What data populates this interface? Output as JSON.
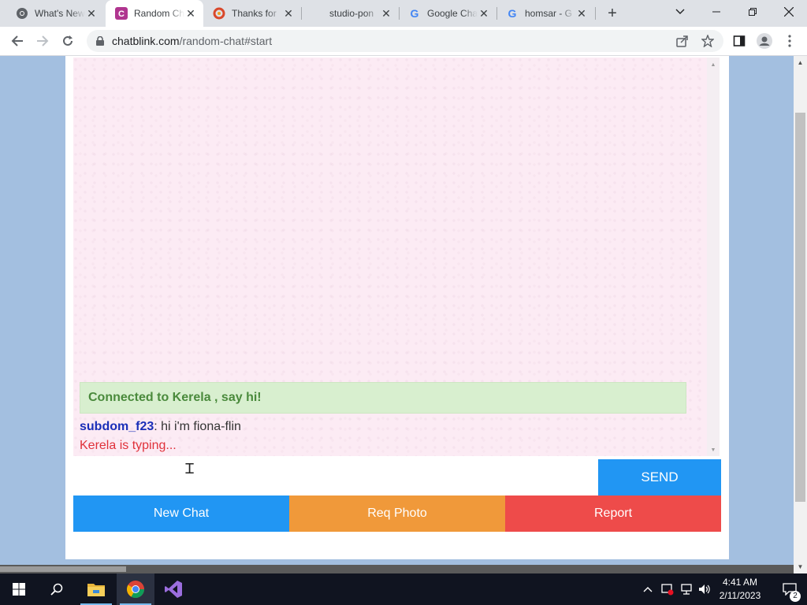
{
  "browser": {
    "tabs": [
      {
        "title": "What's New",
        "icon": "chrome-icon"
      },
      {
        "title": "Random Chat",
        "icon": "chatblink-icon",
        "active": true
      },
      {
        "title": "Thanks for",
        "icon": "swirl-icon"
      },
      {
        "title": "studio-pon",
        "icon": "blank-icon"
      },
      {
        "title": "Google Chat",
        "icon": "google-icon"
      },
      {
        "title": "homsar - G",
        "icon": "google-icon"
      }
    ],
    "new_tab": "+",
    "address": {
      "host": "chatblink.com",
      "path": "/random-chat#start"
    }
  },
  "chat": {
    "status": "Connected to Kerela , say hi!",
    "messages": [
      {
        "sender": "subdom_f23",
        "separator": ":",
        "text": " hi i'm fiona-flin"
      }
    ],
    "typing": "Kerela is typing...",
    "input_value": "",
    "send_label": "SEND"
  },
  "actions": {
    "new_chat": "New Chat",
    "req_photo": "Req Photo",
    "report": "Report"
  },
  "colors": {
    "page_bg": "#a3bfe0",
    "chat_bg": "#fcebf4",
    "send": "#2196f3",
    "new_chat": "#2196f3",
    "req_photo": "#f0993a",
    "report": "#ee4b4a",
    "status_bg": "#d8efcf",
    "status_text": "#4a8a3c",
    "typing_text": "#e0313a",
    "sender_text": "#1a2fb8"
  },
  "taskbar": {
    "time": "4:41 AM",
    "date": "2/11/2023",
    "notifications": "2"
  }
}
